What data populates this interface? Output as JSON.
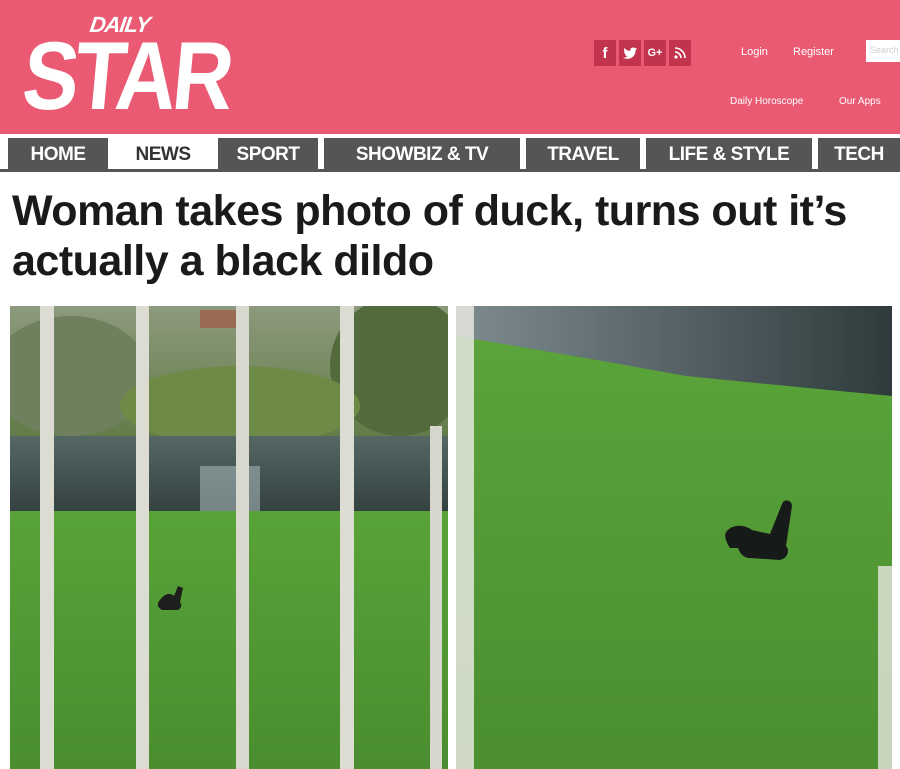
{
  "brand": {
    "top": "DAILY",
    "main": "STAR"
  },
  "social": {
    "facebook": "f",
    "google": "G+"
  },
  "header_links": {
    "login": "Login",
    "register": "Register",
    "search_placeholder": "Search",
    "horoscope": "Daily Horoscope",
    "apps": "Our Apps"
  },
  "nav": [
    "HOME",
    "NEWS",
    "SPORT",
    "SHOWBIZ & TV",
    "TRAVEL",
    "LIFE & STYLE",
    "TECH"
  ],
  "nav_active": "NEWS",
  "article": {
    "headline": "Woman takes photo of duck, turns out it’s actually a black dildo"
  },
  "colors": {
    "header": "#ea5a73",
    "nav": "#555555",
    "grass": "#4f9a35",
    "water": "#3c4a4c"
  }
}
